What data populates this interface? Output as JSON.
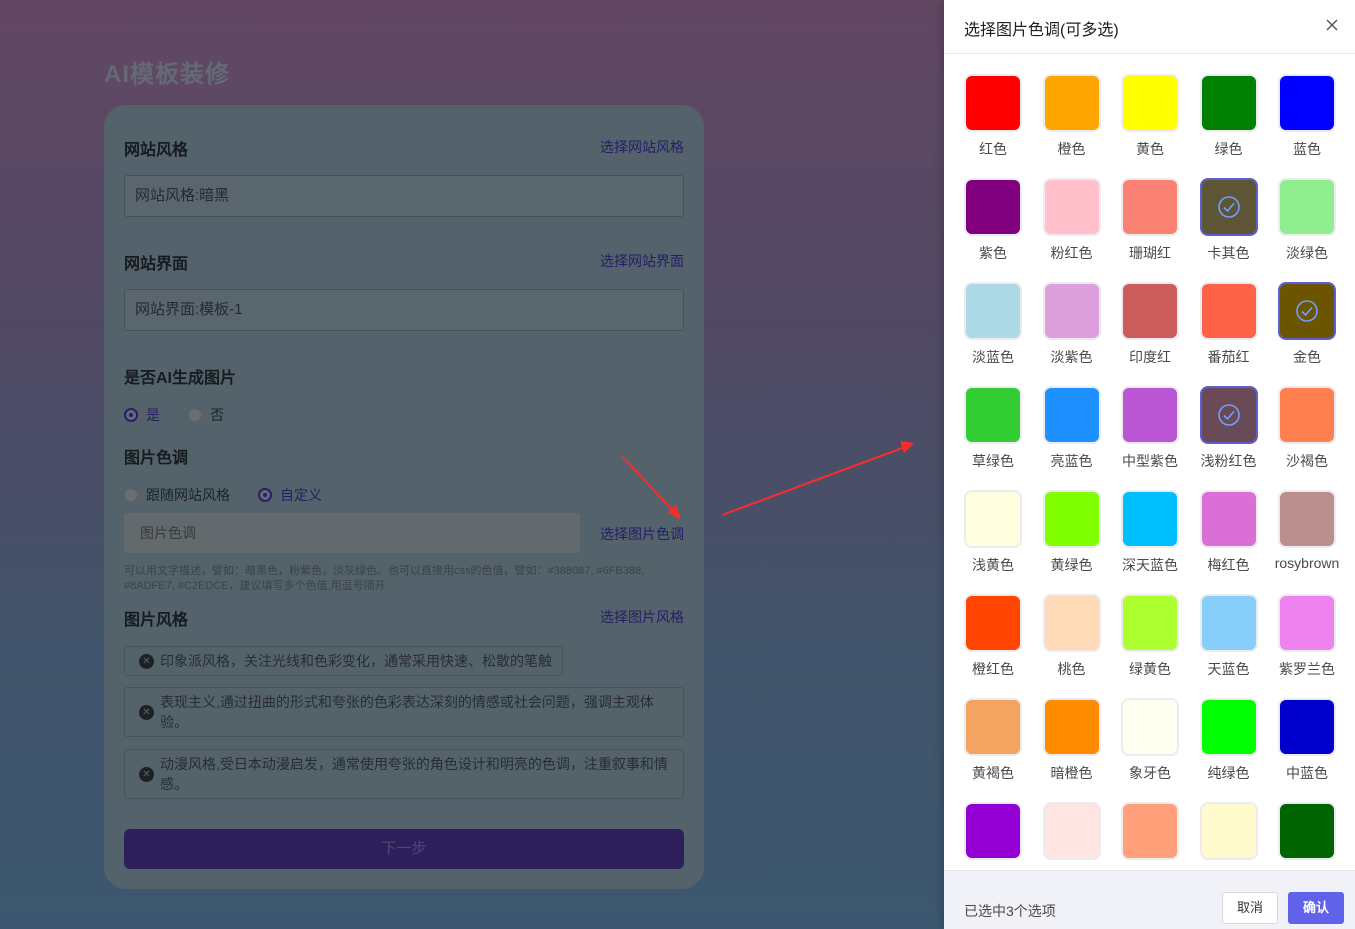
{
  "page": {
    "title": "AI模板装修"
  },
  "form": {
    "style": {
      "label": "网站风格",
      "link": "选择网站风格",
      "value": "网站风格:暗黑"
    },
    "ui": {
      "label": "网站界面",
      "link": "选择网站界面",
      "value": "网站界面:模板-1"
    },
    "ai_image": {
      "label": "是否AI生成图片",
      "yes": "是",
      "no": "否"
    },
    "tone": {
      "label": "图片色调",
      "follow": "跟随网站风格",
      "custom": "自定义",
      "placeholder": "图片色调",
      "link": "选择图片色调",
      "hint": "可以用文字描述，譬如：暗黑色，粉紫色，淡灰绿色。也可以直接用css的色值，譬如：#388087, #6FB388, #8ADFE7, #C2EDCE，建议填写多个色值,用逗号隔开"
    },
    "img_style": {
      "label": "图片风格",
      "link": "选择图片风格",
      "tags": [
        "印象派风格，关注光线和色彩变化，通常采用快速、松散的笔触",
        "表现主义,通过扭曲的形式和夸张的色彩表达深刻的情感或社会问题，强调主观体验。",
        "动漫风格,受日本动漫启发，通常使用夸张的角色设计和明亮的色调，注重叙事和情感。"
      ]
    },
    "next": "下一步"
  },
  "drawer": {
    "title": "选择图片色调(可多选)",
    "selected_count": "已选中3个选项",
    "cancel": "取消",
    "confirm": "确认",
    "colors": [
      {
        "name": "红色",
        "hex": "#ff0000",
        "selected": false
      },
      {
        "name": "橙色",
        "hex": "#ffa500",
        "selected": false
      },
      {
        "name": "黄色",
        "hex": "#ffff00",
        "selected": false
      },
      {
        "name": "绿色",
        "hex": "#008000",
        "selected": false
      },
      {
        "name": "蓝色",
        "hex": "#0000ff",
        "selected": false
      },
      {
        "name": "紫色",
        "hex": "#800080",
        "selected": false
      },
      {
        "name": "粉红色",
        "hex": "#ffc0cb",
        "selected": false
      },
      {
        "name": "珊瑚红",
        "hex": "#fa8072",
        "selected": false
      },
      {
        "name": "卡其色",
        "hex": "#5e5537",
        "selected": true
      },
      {
        "name": "淡绿色",
        "hex": "#90ee90",
        "selected": false
      },
      {
        "name": "淡蓝色",
        "hex": "#add8e6",
        "selected": false
      },
      {
        "name": "淡紫色",
        "hex": "#dda0dd",
        "selected": false
      },
      {
        "name": "印度红",
        "hex": "#cd5c5c",
        "selected": false
      },
      {
        "name": "番茄红",
        "hex": "#ff6347",
        "selected": false
      },
      {
        "name": "金色",
        "hex": "#6b5500",
        "selected": true
      },
      {
        "name": "草绿色",
        "hex": "#32cd32",
        "selected": false
      },
      {
        "name": "亮蓝色",
        "hex": "#1e90ff",
        "selected": false
      },
      {
        "name": "中型紫色",
        "hex": "#ba55d3",
        "selected": false
      },
      {
        "name": "浅粉红色",
        "hex": "#6b4a57",
        "selected": true
      },
      {
        "name": "沙褐色",
        "hex": "#ff7f50",
        "selected": false
      },
      {
        "name": "浅黄色",
        "hex": "#ffffe0",
        "selected": false
      },
      {
        "name": "黄绿色",
        "hex": "#7fff00",
        "selected": false
      },
      {
        "name": "深天蓝色",
        "hex": "#00bfff",
        "selected": false
      },
      {
        "name": "梅红色",
        "hex": "#da70d6",
        "selected": false
      },
      {
        "name": "rosybrown",
        "hex": "#bc8f8f",
        "selected": false
      },
      {
        "name": "橙红色",
        "hex": "#ff4500",
        "selected": false
      },
      {
        "name": "桃色",
        "hex": "#ffdab9",
        "selected": false
      },
      {
        "name": "绿黄色",
        "hex": "#adff2f",
        "selected": false
      },
      {
        "name": "天蓝色",
        "hex": "#87cefa",
        "selected": false
      },
      {
        "name": "紫罗兰色",
        "hex": "#ee82ee",
        "selected": false
      },
      {
        "name": "黄褐色",
        "hex": "#f4a460",
        "selected": false
      },
      {
        "name": "暗橙色",
        "hex": "#ff8c00",
        "selected": false
      },
      {
        "name": "象牙色",
        "hex": "#fffff0",
        "selected": false
      },
      {
        "name": "纯绿色",
        "hex": "#00ff00",
        "selected": false
      },
      {
        "name": "中蓝色",
        "hex": "#0000cd",
        "selected": false
      },
      {
        "name": "",
        "hex": "#9400d3",
        "selected": false
      },
      {
        "name": "",
        "hex": "#ffe4e1",
        "selected": false
      },
      {
        "name": "",
        "hex": "#ffa07a",
        "selected": false
      },
      {
        "name": "",
        "hex": "#fffacd",
        "selected": false
      },
      {
        "name": "",
        "hex": "#006400",
        "selected": false
      }
    ]
  },
  "theme": {
    "accent": "#5d5fd3",
    "confirm_bg": "#6062ea",
    "arrow": "#ff2a2a"
  }
}
